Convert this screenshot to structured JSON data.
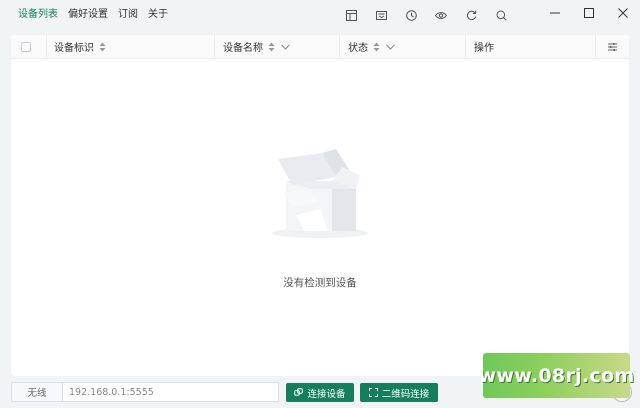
{
  "menu": {
    "items": [
      {
        "label": "设备列表",
        "active": true
      },
      {
        "label": "偏好设置",
        "active": false
      },
      {
        "label": "订阅",
        "active": false
      },
      {
        "label": "关于",
        "active": false
      }
    ]
  },
  "toolbar": {
    "icons": [
      "layout-icon",
      "inbox-icon",
      "clock-icon",
      "eye-icon",
      "refresh-icon",
      "search-icon"
    ]
  },
  "window": {
    "controls": [
      "minimize-icon",
      "maximize-icon",
      "close-icon"
    ]
  },
  "table": {
    "columns": [
      {
        "label": "",
        "type": "checkbox"
      },
      {
        "label": "设备标识",
        "sortable": true,
        "filter": false
      },
      {
        "label": "设备名称",
        "sortable": true,
        "filter": true
      },
      {
        "label": "状态",
        "sortable": true,
        "filter": true
      },
      {
        "label": "操作",
        "sortable": false,
        "filter": false
      },
      {
        "label": "",
        "type": "settings"
      }
    ],
    "rows": [],
    "empty_text": "没有检测到设备"
  },
  "bottom": {
    "mode_label": "无线",
    "address_value": "192.168.0.1:5555",
    "connect_button": "连接设备",
    "qr_button": "二维码连接"
  },
  "watermark": {
    "text": "www.08rj.com"
  },
  "colors": {
    "accent": "#157e5c",
    "background": "#f2f3f5",
    "panel": "#ffffff"
  }
}
